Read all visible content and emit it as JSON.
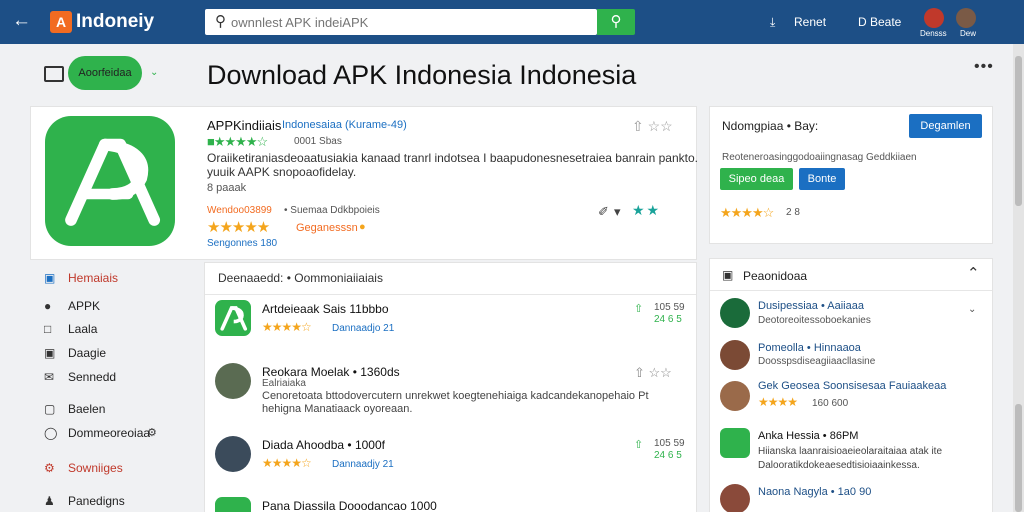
{
  "header": {
    "brand": "Indoneiy",
    "logo_text": "A",
    "search_placeholder": "ownnlest APK indeiAPK",
    "btn1_label": "Renet",
    "btn2_label": "D Beate",
    "sub1": "Densss",
    "sub2": "Dew"
  },
  "left_pill": "Aoorfeidaa",
  "page_title": "Download APK Indonesia Indonesia",
  "app": {
    "name": "APPKindiiais",
    "publisher": "Indonesaiaa (Kurame-49)",
    "rating_small": "0001 Sbas",
    "desc_line1": "Oraiiketiraniasdeoaatusiakia kanaad tranrl indotsea I baapudonesnesetraiea banrain pankto.",
    "desc_line2": "yuuik AAPK snopoaofidelay.",
    "meta": "8 paaak",
    "downloads_label": "Wendoo03899",
    "downloads_extra": "• Suemaa Ddkbpoieis",
    "badge": "Geganesssn",
    "size": "Sengonnes 180"
  },
  "download_card": {
    "title": "Ndomgpiaa • Bay:",
    "download_btn": "Degamlen",
    "desc": "Reoteneroasinggodoaiingnasag Geddkiiaen",
    "btn_green": "Sipeo deaa",
    "btn_blue": "Bonte",
    "rating": "2 8"
  },
  "sidebar": {
    "items": [
      "Hemaiais",
      "APPK",
      "Laala",
      "Daagie",
      "Sennedd",
      "Baelen",
      "Dommeoreoiaa",
      "Sowniiges",
      "Panedigns"
    ]
  },
  "list": {
    "header": "Deenaaedd: • Oommoniaiiaiais",
    "items": [
      {
        "title": "Artdeieaak Sais 11bbbo",
        "sub": "Dannaadjo 21",
        "right_top": "105 59",
        "right_bottom": "24 6 5"
      },
      {
        "title": "Reokara Moelak • 1360ds",
        "sub": "Ealriaiaka",
        "desc1": "Cenoretoata bttodovercutern unrekwet koegtenehiaiga kadcandekanopehaio Pt",
        "desc2": "hehigna Manatiaack oyoreaan."
      },
      {
        "title": "Diada Ahoodba • 1000f",
        "sub": "Dannaadjy 21",
        "right_top": "105 59",
        "right_bottom": "24 6 5"
      },
      {
        "title": "Pana Diassila Dooodancao 1000"
      }
    ]
  },
  "popular": {
    "title": "Peaonidoaa",
    "items": [
      {
        "name": "Dusipessiaa • Aaiiaaa",
        "sub": "Deotoreoitessoboekanies"
      },
      {
        "name": "Pomeolla • Hinnaaoa",
        "sub": "Doosspsdiseagiiaacllasine"
      },
      {
        "name": "Gek Geosea Soonsisesaa Fauiaakeaa",
        "sub": "160 600"
      },
      {
        "name": "Anka Hessia • 86PM",
        "sub": "Hiianska laanraisioaeieolaraitaiaa atak ite",
        "sub2": "Dalooratikdokeaesedtisioiaainkessa."
      },
      {
        "name": "Naona Nagyla • 1a0 90"
      }
    ]
  }
}
